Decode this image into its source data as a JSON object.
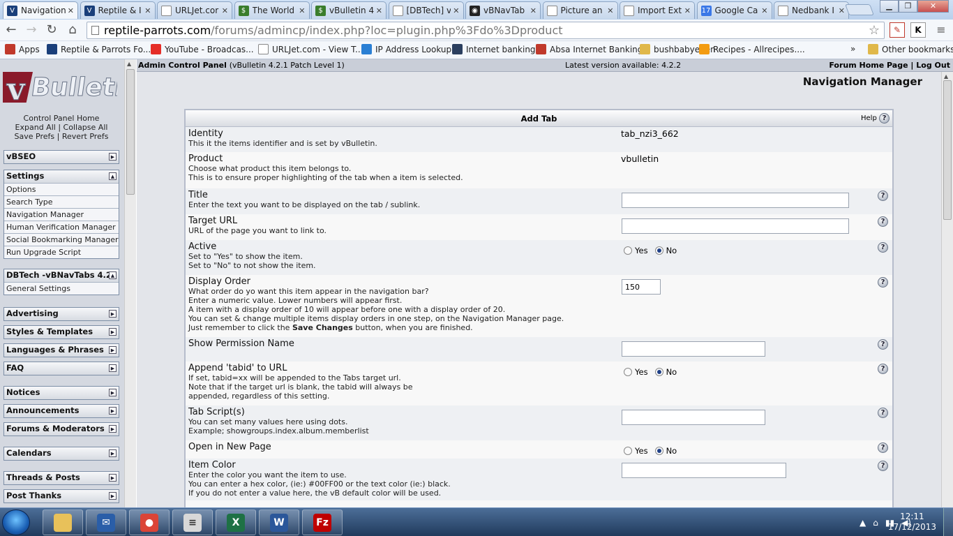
{
  "browser": {
    "tabs": [
      {
        "title": "Navigation",
        "icon": "vbulletin-icon",
        "color": "#1a3f7a",
        "glyph": "V",
        "active": true
      },
      {
        "title": "Reptile & I",
        "icon": "vbulletin-icon",
        "color": "#1a3f7a",
        "glyph": "V"
      },
      {
        "title": "URLJet.cor",
        "icon": "page-icon",
        "color": "#ffffff",
        "glyph": ""
      },
      {
        "title": "The World",
        "icon": "dollar-icon",
        "color": "#3a7d2c",
        "glyph": "$"
      },
      {
        "title": "vBulletin 4",
        "icon": "dollar-icon",
        "color": "#3a7d2c",
        "glyph": "$"
      },
      {
        "title": "[DBTech] v",
        "icon": "page-icon",
        "color": "#ffffff",
        "glyph": ""
      },
      {
        "title": "vBNavTab",
        "icon": "dbtech-icon",
        "color": "#222222",
        "glyph": "◉"
      },
      {
        "title": "Picture an",
        "icon": "page-icon",
        "color": "#ffffff",
        "glyph": ""
      },
      {
        "title": "Import Ext",
        "icon": "page-icon",
        "color": "#ffffff",
        "glyph": ""
      },
      {
        "title": "Google Ca",
        "icon": "calendar-icon",
        "color": "#3b78e7",
        "glyph": "17"
      },
      {
        "title": "Nedbank I",
        "icon": "page-icon",
        "color": "#ffffff",
        "glyph": ""
      }
    ],
    "url_host": "reptile-parrots.com",
    "url_path": "/forums/admincp/index.php?loc=plugin.php%3Fdo%3Dproduct",
    "extensions": [
      "K"
    ],
    "bookmarks": [
      {
        "label": "Apps",
        "icon": "apps-icon",
        "color": "#c0392b"
      },
      {
        "label": "Reptile & Parrots Fo...",
        "icon": "vbulletin-icon",
        "color": "#1a3f7a"
      },
      {
        "label": "YouTube - Broadcas...",
        "icon": "youtube-icon",
        "color": "#e52d27"
      },
      {
        "label": "URLJet.com - View T...",
        "icon": "page-icon",
        "color": "#ffffff"
      },
      {
        "label": "IP Address Lookup",
        "icon": "globe-icon",
        "color": "#2a7fd4"
      },
      {
        "label": "Internet banking",
        "icon": "shield-icon",
        "color": "#2b3f5f"
      },
      {
        "label": "Absa Internet Banking",
        "icon": "absa-icon",
        "color": "#c0392b"
      },
      {
        "label": "bushbabyeden",
        "icon": "folder-icon",
        "color": "#e0b84a"
      },
      {
        "label": "Recipes - Allrecipes....",
        "icon": "allrecipes-icon",
        "color": "#f39c12"
      }
    ],
    "bookmark_overflow": "»",
    "other_bookmarks": "Other bookmarks"
  },
  "sidebar": {
    "links": {
      "home": "Control Panel Home",
      "expand": "Expand All",
      "collapse": "Collapse All",
      "save": "Save Prefs",
      "revert": "Revert Prefs",
      "sep": "|"
    },
    "groups": [
      {
        "title": "vBSEO",
        "expanded": false,
        "items": []
      },
      {
        "title": "Settings",
        "expanded": true,
        "items": [
          "Options",
          "Search Type",
          "Navigation Manager",
          "Human Verification Manager",
          "Social Bookmarking Manager",
          "Run Upgrade Script"
        ]
      },
      {
        "title": "DBTech -vBNavTabs 4.2",
        "expanded": true,
        "items": [
          "General Settings"
        ]
      },
      {
        "title": "Advertising",
        "expanded": false,
        "items": []
      },
      {
        "title": "Styles & Templates",
        "expanded": false,
        "items": []
      },
      {
        "title": "Languages & Phrases",
        "expanded": false,
        "items": []
      },
      {
        "title": "FAQ",
        "expanded": false,
        "items": []
      },
      {
        "title": "Notices",
        "expanded": false,
        "items": []
      },
      {
        "title": "Announcements",
        "expanded": false,
        "items": []
      },
      {
        "title": "Forums & Moderators",
        "expanded": false,
        "items": []
      },
      {
        "title": "Calendars",
        "expanded": false,
        "items": []
      },
      {
        "title": "Threads & Posts",
        "expanded": false,
        "items": []
      },
      {
        "title": "Post Thanks",
        "expanded": false,
        "items": []
      }
    ]
  },
  "header": {
    "title": "Admin Control Panel",
    "version": "(vBulletin 4.2.1 Patch Level 1)",
    "latest": "Latest version available: 4.2.2",
    "forum_home": "Forum Home Page",
    "sep": "|",
    "logout": "Log Out"
  },
  "page_title": "Navigation Manager",
  "form": {
    "title": "Add Tab",
    "help": "Help",
    "help_glyph": "?",
    "yes": "Yes",
    "no": "No",
    "rows": [
      {
        "label": "Identity",
        "desc": [
          "This it the items identifier and is set by vBulletin."
        ],
        "value": "tab_nzi3_662"
      },
      {
        "label": "Product",
        "desc": [
          "Choose what product this item belongs to.",
          "This is to ensure proper highlighting of the tab when a item is selected."
        ],
        "value": "vbulletin"
      },
      {
        "label": "Title",
        "desc": [
          "Enter the text you want to be displayed on the tab / sublink."
        ],
        "input": ""
      },
      {
        "label": "Target URL",
        "desc": [
          "URL of the page you want to link to."
        ],
        "input": ""
      },
      {
        "label": "Active",
        "desc": [
          "Set to \"Yes\" to show the item.",
          "Set to \"No\" to not show the item."
        ],
        "radio": "no"
      },
      {
        "label": "Display Order",
        "desc": [
          "What order do yo want this item appear in the navigation bar?",
          "Enter a numeric value. Lower numbers will appear first.",
          "A item with a display order of 10 will appear before one with a display order of 20.",
          "You can set & change multiple items display orders in one step, on the Navigation Manager page."
        ],
        "desc_last_pre": "Just remember to click the ",
        "desc_last_bold": "Save Changes",
        "desc_last_post": " button, when you are finished.",
        "input": "150"
      },
      {
        "label": "Show Permission Name",
        "desc": [],
        "input": ""
      },
      {
        "label": "Append 'tabid' to URL",
        "desc": [
          "If set, tabid=xx will be appended to the Tabs target url.",
          "Note that if the target url is blank, the tabid will always be",
          "appended, regardless of this setting."
        ],
        "radio": "no"
      },
      {
        "label": "Tab Script(s)",
        "desc": [
          "You can set many values here using dots.",
          "Example; showgroups.index.album.memberlist"
        ],
        "input": ""
      },
      {
        "label": "Open in New Page",
        "desc": [],
        "radio": "no"
      },
      {
        "label": "Item Color",
        "desc": [
          "Enter the color you want the item to use.",
          "You can enter a hex color, (ie:) #00FF00 or the text color (ie:) black.",
          "If you do not enter a value here, the vB default color will be used."
        ],
        "input": ""
      }
    ]
  },
  "taskbar": {
    "apps": [
      {
        "name": "explorer",
        "icon": "folder-icon",
        "color": "#e8c15a",
        "glyph": ""
      },
      {
        "name": "thunderbird",
        "icon": "thunderbird-icon",
        "color": "#2a5ea8",
        "glyph": "✉"
      },
      {
        "name": "chrome",
        "icon": "chrome-icon",
        "color": "#db4437",
        "glyph": "●"
      },
      {
        "name": "notepad",
        "icon": "notepad-icon",
        "color": "#d8d8d8",
        "glyph": "≡"
      },
      {
        "name": "excel",
        "icon": "excel-icon",
        "color": "#1e7145",
        "glyph": "X"
      },
      {
        "name": "word",
        "icon": "word-icon",
        "color": "#2b579a",
        "glyph": "W"
      },
      {
        "name": "filezilla",
        "icon": "filezilla-icon",
        "color": "#bf0000",
        "glyph": "Fz"
      }
    ],
    "tray": [
      "▲",
      "⌂",
      "▮▮",
      "◀)"
    ],
    "time": "12:11",
    "date": "17/12/2013"
  }
}
